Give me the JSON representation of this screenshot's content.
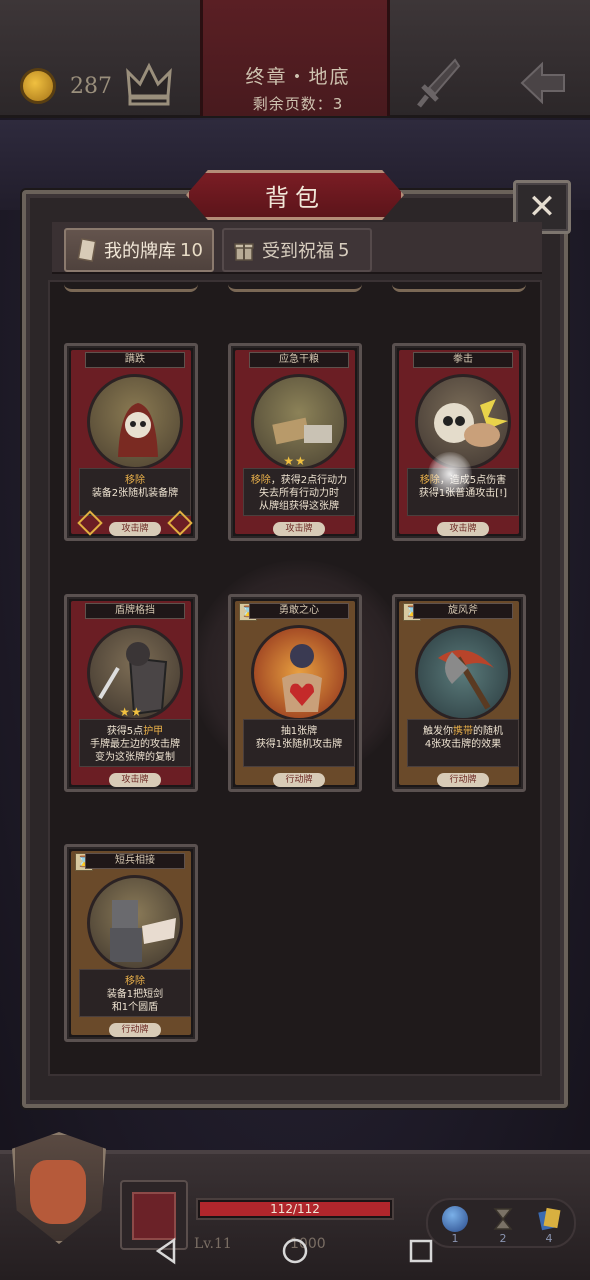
{
  "topbar": {
    "coins": "287",
    "chapter_title": "终章・地底",
    "pages_left": "剩余页数：3"
  },
  "panel": {
    "title": "背包",
    "close_glyph": "✕"
  },
  "tabs": [
    {
      "label": "我的牌库",
      "count": "10"
    },
    {
      "label": "受到祝福",
      "count": "5"
    }
  ],
  "cards": [
    {
      "name": "蹒跌",
      "line1": "移除",
      "line2": "装备2张随机装备牌",
      "line3": "",
      "type": "攻击牌",
      "stars": ""
    },
    {
      "name": "应急干粮",
      "line1": "移除，获得2点行动力",
      "line2": "失去所有行动力时",
      "line3": "从牌组获得这张牌",
      "type": "攻击牌",
      "stars": "★★"
    },
    {
      "name": "拳击",
      "line1": "移除，造成5点伤害",
      "line2": "获得1张普通攻击[!]",
      "line3": "",
      "type": "攻击牌",
      "stars": ""
    },
    {
      "name": "盾牌格挡",
      "line1": "获得5点护甲",
      "line2": "手牌最左边的攻击牌",
      "line3": "变为这张牌的复制",
      "type": "攻击牌",
      "stars": "★★"
    },
    {
      "name": "勇敢之心",
      "line1": "抽1张牌",
      "line2": "获得1张随机攻击牌",
      "line3": "",
      "type": "行动牌",
      "stars": ""
    },
    {
      "name": "旋风斧",
      "line1": "触发你携带的随机",
      "line2": "4张攻击牌的效果",
      "line3": "",
      "type": "行动牌",
      "stars": ""
    },
    {
      "name": "短兵相接",
      "line1": "移除",
      "line2": "装备1把短剑",
      "line3": "和1个圆盾",
      "type": "行动牌",
      "stars": ""
    }
  ],
  "hud": {
    "hp": "112/112",
    "hp_fraction": 1.0,
    "level": "Lv.11",
    "xp": "1000",
    "items": [
      "1",
      "2",
      "4"
    ]
  },
  "colors": {
    "attack_card": "#6b1e24",
    "action_card": "#6a4a2a",
    "hp_red": "#b0262c",
    "highlight_gold": "#e9b04a"
  }
}
